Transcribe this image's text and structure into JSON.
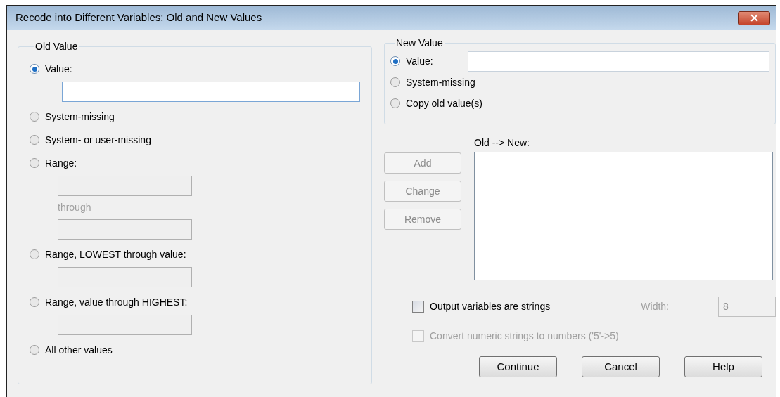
{
  "window": {
    "title": "Recode into Different Variables: Old and New Values"
  },
  "old_value": {
    "title": "Old Value",
    "items": [
      {
        "kind": "radio",
        "label": "Value:",
        "selected": true
      },
      {
        "kind": "field",
        "disabled": false
      },
      {
        "kind": "radio",
        "label": "System-missing",
        "selected": false
      },
      {
        "kind": "radio",
        "label": "System- or user-missing",
        "selected": false
      },
      {
        "kind": "radio",
        "label": "Range:",
        "selected": false
      },
      {
        "kind": "field",
        "disabled": true
      },
      {
        "kind": "caption",
        "text": "through"
      },
      {
        "kind": "field",
        "disabled": true
      },
      {
        "kind": "radio",
        "label": "Range, LOWEST through value:",
        "selected": false
      },
      {
        "kind": "field",
        "disabled": true
      },
      {
        "kind": "radio",
        "label": "Range, value through HIGHEST:",
        "selected": false
      },
      {
        "kind": "field",
        "disabled": true
      },
      {
        "kind": "radio",
        "label": "All other values",
        "selected": false
      }
    ]
  },
  "new_value": {
    "title": "New Value",
    "options": [
      {
        "label": "Value:",
        "selected": true,
        "has_field": true
      },
      {
        "label": "System-missing",
        "selected": false,
        "has_field": false
      },
      {
        "label": "Copy old value(s)",
        "selected": false,
        "has_field": false
      }
    ]
  },
  "list_buttons": [
    {
      "label": "Add",
      "disabled": true
    },
    {
      "label": "Change",
      "disabled": true
    },
    {
      "label": "Remove",
      "disabled": true
    }
  ],
  "mapping": {
    "label": "Old --> New:"
  },
  "checkboxes": [
    {
      "label": "Output variables are strings",
      "checked": false,
      "disabled": false
    },
    {
      "label": "Convert numeric strings to numbers ('5'->5)",
      "checked": false,
      "disabled": true
    }
  ],
  "width": {
    "label": "Width:",
    "value": "8",
    "disabled": true
  },
  "buttons": [
    {
      "label": "Continue"
    },
    {
      "label": "Cancel"
    },
    {
      "label": "Help"
    }
  ]
}
